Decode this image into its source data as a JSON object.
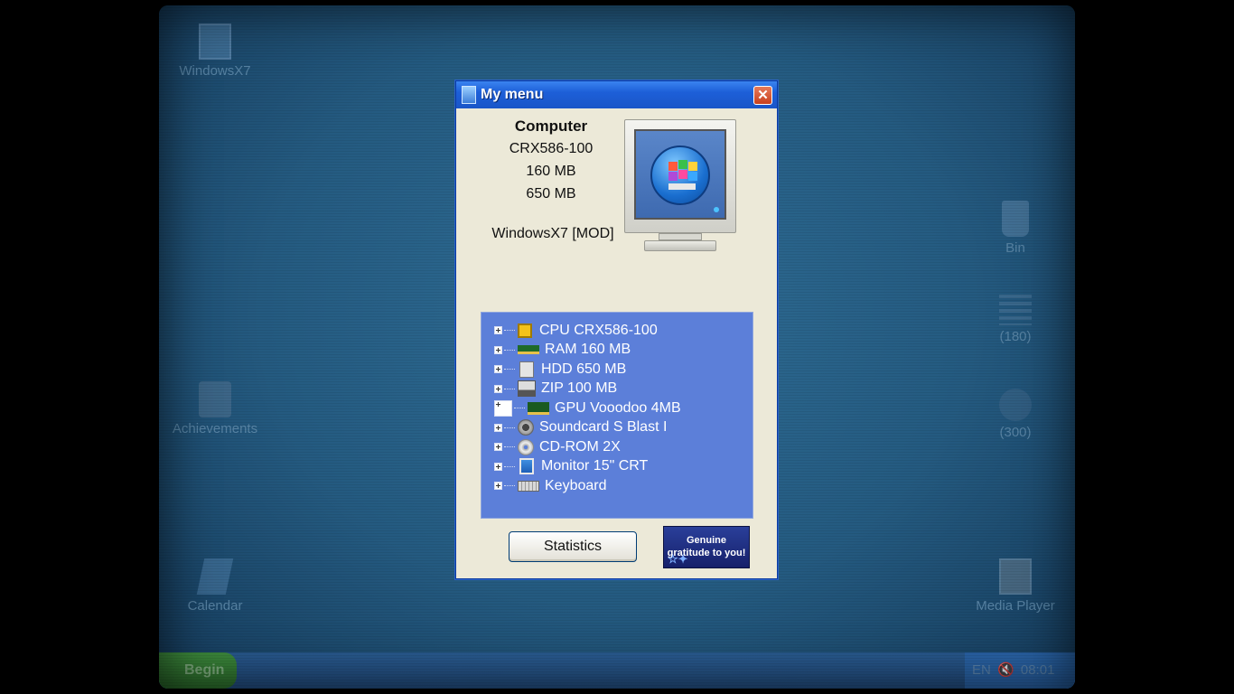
{
  "desktop": {
    "icons": [
      {
        "label": "WindowsX7",
        "icon": "computer-logo-icon"
      },
      {
        "label": "Achievements",
        "icon": "trophy-icon"
      },
      {
        "label": "Calendar",
        "icon": "calendar-icon"
      },
      {
        "label": "Bin",
        "icon": "recycle-bin-icon"
      },
      {
        "label": "(180)",
        "icon": "list-icon"
      },
      {
        "label": "(300)",
        "icon": "app-icon"
      },
      {
        "label": "Media Player",
        "icon": "media-player-icon"
      }
    ]
  },
  "taskbar": {
    "start_label": "Begin",
    "language": "EN",
    "clock": "08:01 PM"
  },
  "window": {
    "title": "My menu",
    "close_label": "✕",
    "computer_heading": "Computer",
    "cpu_model": "CRX586-100",
    "ram": "160 MB",
    "hdd": "650 MB",
    "os": "WindowsX7 [MOD]",
    "hardware": [
      {
        "label": "CPU CRX586-100",
        "icon": "cpu-chip-icon"
      },
      {
        "label": "RAM 160 MB",
        "icon": "ram-stick-icon"
      },
      {
        "label": "HDD 650 MB",
        "icon": "hard-drive-icon"
      },
      {
        "label": "ZIP 100 MB",
        "icon": "zip-drive-icon"
      },
      {
        "label": "GPU Vooodoo 4MB",
        "icon": "gpu-card-icon"
      },
      {
        "label": "Soundcard S Blast I",
        "icon": "speaker-icon"
      },
      {
        "label": "CD-ROM 2X",
        "icon": "cd-disc-icon"
      },
      {
        "label": "Monitor 15\" CRT",
        "icon": "monitor-icon"
      },
      {
        "label": "Keyboard",
        "icon": "keyboard-icon"
      }
    ],
    "statistics_label": "Statistics",
    "gratitude_label": "Genuine gratitude to you!"
  },
  "colors": {
    "desktop": "#2a6488",
    "titlebar": "#1d5fd8",
    "tree_bg": "#5c7fd9",
    "window_bg": "#ece9d8"
  }
}
